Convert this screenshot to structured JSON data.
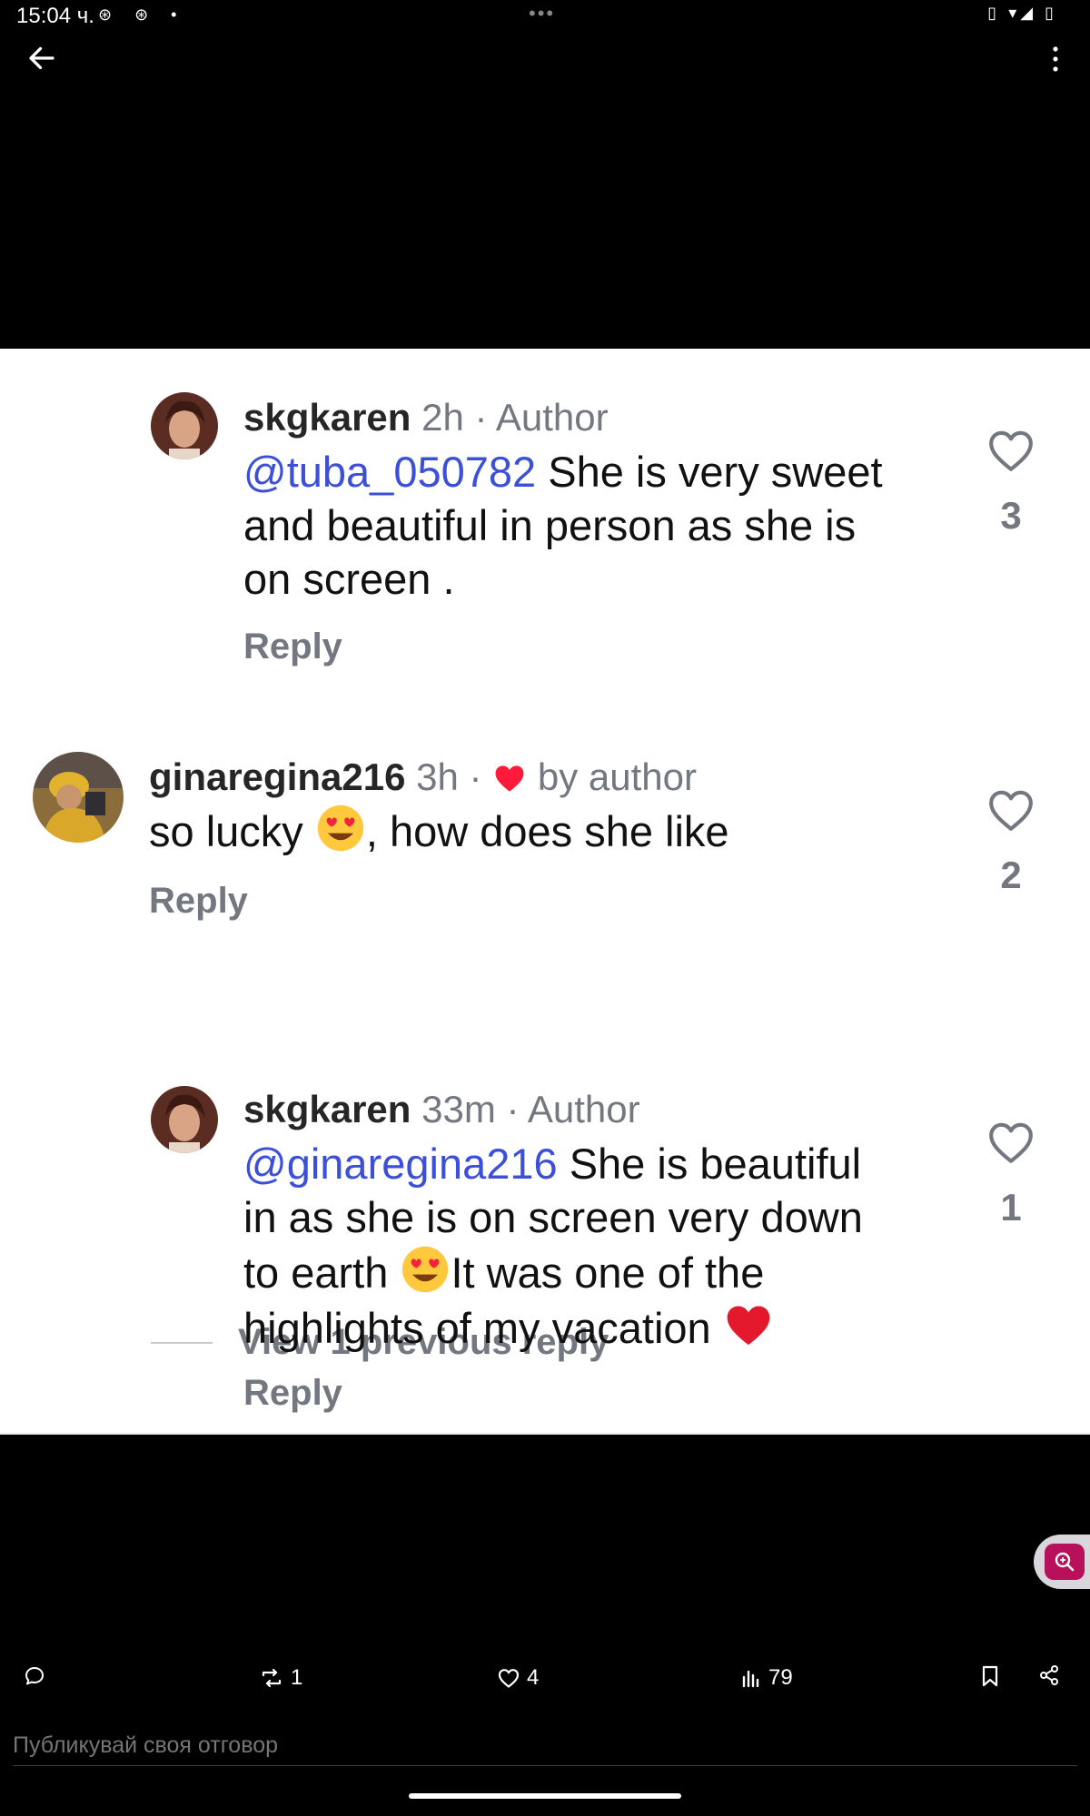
{
  "status_bar": {
    "time": "15:04 ч.",
    "left_icons": "⊛ ⊛ •",
    "center_dots": "•••",
    "right_icons": "▯ ▾◢ ▯"
  },
  "comments": [
    {
      "username": "skgkaren",
      "meta": " 2h · Author",
      "mention": "@tuba_050782",
      "text_lines": [
        " She is very sweet",
        "and beautiful in person as she is",
        "on screen ."
      ],
      "reply_label": "Reply",
      "likes": "3"
    },
    {
      "username": "ginaregina216",
      "meta_prefix": " 3h · ",
      "meta_suffix": " by author",
      "text_before_emoji": "so lucky ",
      "text_after_emoji": ", how does she like",
      "reply_label": "Reply",
      "likes": "2"
    },
    {
      "username": "skgkaren",
      "meta": " 33m · Author",
      "mention": "@ginaregina216",
      "line1": " She is beautiful",
      "line2": "in as she is on screen very down",
      "line3_before": "to earth ",
      "line3_after": "It was one of the",
      "line4": "highlights of my vacation ",
      "reply_label": "Reply",
      "likes": "1"
    }
  ],
  "view_previous": "View 1 previous reply",
  "actions": {
    "reposts": "1",
    "likes": "4",
    "views": "79"
  },
  "reply_input": {
    "placeholder": "Публикувай своя отговор"
  },
  "colors": {
    "mention": "#3b4fd8",
    "muted": "#737780",
    "liked_red": "#ff1a3c",
    "zoom_accent": "#b8105a"
  }
}
